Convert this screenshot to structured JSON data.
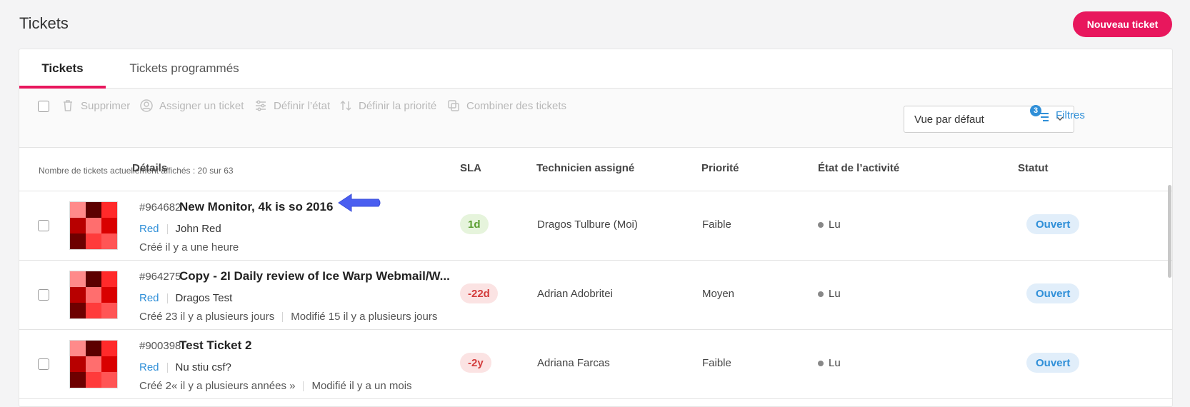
{
  "page": {
    "title": "Tickets",
    "new_ticket_label": "Nouveau ticket"
  },
  "tabs": [
    {
      "label": "Tickets",
      "active": true
    },
    {
      "label": "Tickets programmés",
      "active": false
    }
  ],
  "toolbar": {
    "actions": [
      {
        "label": "Supprimer",
        "icon": "trash-icon"
      },
      {
        "label": "Assigner un ticket",
        "icon": "user-circle-icon"
      },
      {
        "label": "Définir l’état",
        "icon": "sliders-icon"
      },
      {
        "label": "Définir la priorité",
        "icon": "sort-arrows-icon"
      },
      {
        "label": "Combiner des tickets",
        "icon": "combine-icon"
      }
    ],
    "count_text": "Nombre de tickets actuellement affichés : 20 sur 63",
    "view_select": "Vue par défaut",
    "filters_label": "Filtres",
    "filters_count": "3"
  },
  "columns": [
    "Détails",
    "SLA",
    "Technicien assigné",
    "Priorité",
    "État de l’activité",
    "Statut"
  ],
  "tickets": [
    {
      "id": "#964682",
      "title": "New Monitor, 4k is so 2016",
      "team": "Red",
      "requester": "John Red",
      "created": "Créé il y a une heure",
      "modified": "",
      "sla": "1d",
      "sla_state": "ok",
      "technician": "Dragos Tulbure (Moi)",
      "priority": "Faible",
      "activity": "Lu",
      "status": "Ouvert"
    },
    {
      "id": "#964275",
      "title": "Copy - 2I Daily review of Ice Warp Webmail/W...",
      "team": "Red",
      "requester": "Dragos Test",
      "created": "Créé 23 il y a plusieurs jours",
      "modified": "Modifié 15 il y a plusieurs jours",
      "sla": "-22d",
      "sla_state": "overdue",
      "technician": "Adrian Adobritei",
      "priority": "Moyen",
      "activity": "Lu",
      "status": "Ouvert"
    },
    {
      "id": "#900398",
      "title": "Test Ticket 2",
      "team": "Red",
      "requester": "Nu stiu csf?",
      "created": "Créé 2« il y a plusieurs années »",
      "modified": "Modifié il y a un mois",
      "sla": "-2y",
      "sla_state": "overdue",
      "technician": "Adriana Farcas",
      "priority": "Faible",
      "activity": "Lu",
      "status": "Ouvert"
    }
  ],
  "colors": {
    "accent": "#e8175d",
    "link": "#2f8fd8",
    "sla_ok_bg": "#e6f4dc",
    "sla_ok_fg": "#5a9e2e",
    "sla_overdue_bg": "#fbe3e3",
    "sla_overdue_fg": "#d33c3c",
    "annotation_arrow": "#4a5ef0"
  }
}
